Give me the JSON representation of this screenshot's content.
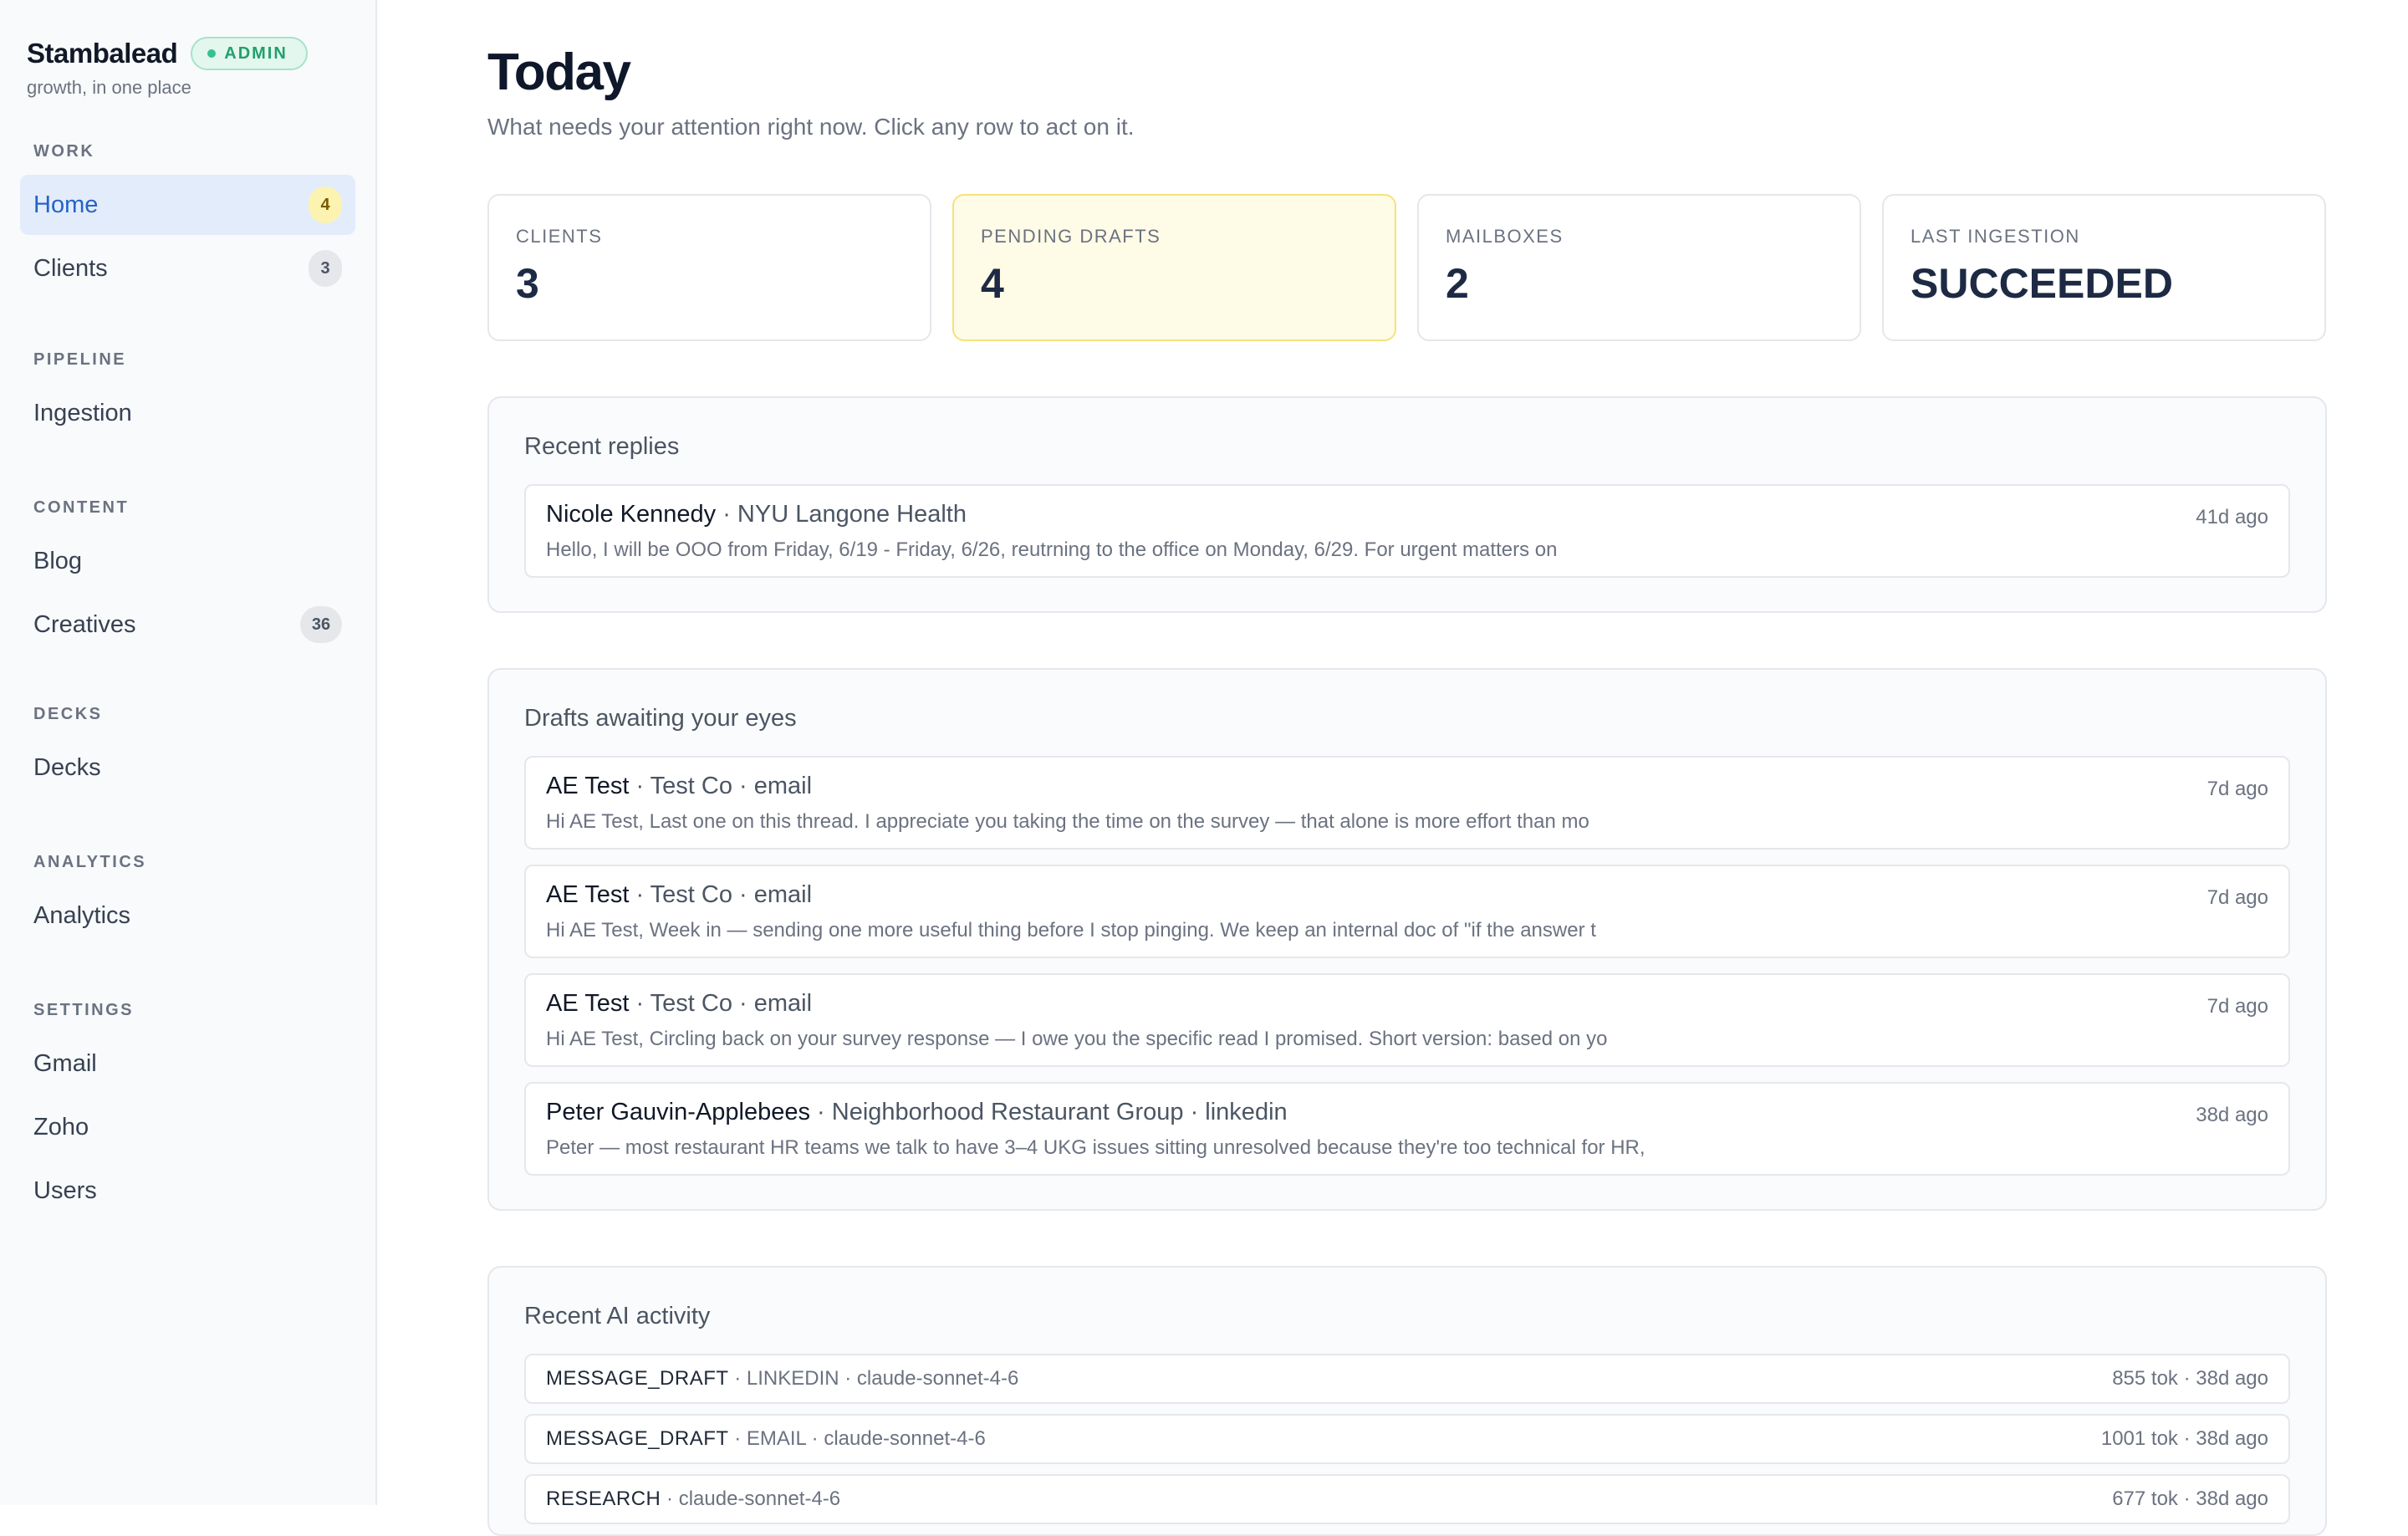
{
  "brand": {
    "name": "Stambalead",
    "badge": "ADMIN",
    "tagline": "growth, in one place"
  },
  "sidebar": {
    "sections": [
      {
        "label": "WORK",
        "items": [
          {
            "label": "Home",
            "badge": "4",
            "active": true
          },
          {
            "label": "Clients",
            "badge": "3"
          }
        ]
      },
      {
        "label": "PIPELINE",
        "items": [
          {
            "label": "Ingestion"
          }
        ]
      },
      {
        "label": "CONTENT",
        "items": [
          {
            "label": "Blog"
          },
          {
            "label": "Creatives",
            "badge": "36"
          }
        ]
      },
      {
        "label": "DECKS",
        "items": [
          {
            "label": "Decks"
          }
        ]
      },
      {
        "label": "ANALYTICS",
        "items": [
          {
            "label": "Analytics"
          }
        ]
      },
      {
        "label": "SETTINGS",
        "items": [
          {
            "label": "Gmail"
          },
          {
            "label": "Zoho"
          },
          {
            "label": "Users"
          }
        ]
      }
    ]
  },
  "header": {
    "title": "Today",
    "subtitle": "What needs your attention right now. Click any row to act on it."
  },
  "stats": [
    {
      "label": "CLIENTS",
      "value": "3"
    },
    {
      "label": "PENDING DRAFTS",
      "value": "4"
    },
    {
      "label": "MAILBOXES",
      "value": "2"
    },
    {
      "label": "LAST INGESTION",
      "value": "SUCCEEDED"
    }
  ],
  "recent_replies": {
    "title": "Recent replies",
    "rows": [
      {
        "name": "Nicole Kennedy",
        "meta": " · NYU Langone Health",
        "time": "41d ago",
        "body": "Hello, I will be OOO from Friday, 6/19 - Friday, 6/26, reutrning to the office on Monday, 6/29. For urgent matters on"
      }
    ]
  },
  "drafts": {
    "title": "Drafts awaiting your eyes",
    "rows": [
      {
        "name": "AE Test",
        "meta": " · Test Co · email",
        "time": "7d ago",
        "body": "Hi AE Test, Last one on this thread. I appreciate you taking the time on the survey — that alone is more effort than mo"
      },
      {
        "name": "AE Test",
        "meta": " · Test Co · email",
        "time": "7d ago",
        "body": "Hi AE Test, Week in — sending one more useful thing before I stop pinging. We keep an internal doc of \"if the answer t"
      },
      {
        "name": "AE Test",
        "meta": " · Test Co · email",
        "time": "7d ago",
        "body": "Hi AE Test, Circling back on your survey response — I owe you the specific read I promised. Short version: based on yo"
      },
      {
        "name": "Peter Gauvin-Applebees",
        "meta": " · Neighborhood Restaurant Group · linkedin",
        "time": "38d ago",
        "body": "Peter — most restaurant HR teams we talk to have 3–4 UKG issues sitting unresolved because they're too technical for HR,"
      }
    ]
  },
  "ai_activity": {
    "title": "Recent AI activity",
    "rows": [
      {
        "kind": "MESSAGE_DRAFT",
        "meta": " · LINKEDIN · claude-sonnet-4-6",
        "stats": "855 tok · 38d ago"
      },
      {
        "kind": "MESSAGE_DRAFT",
        "meta": " · EMAIL · claude-sonnet-4-6",
        "stats": "1001 tok · 38d ago"
      },
      {
        "kind": "RESEARCH",
        "meta": " · claude-sonnet-4-6",
        "stats": "677 tok · 38d ago"
      }
    ]
  }
}
